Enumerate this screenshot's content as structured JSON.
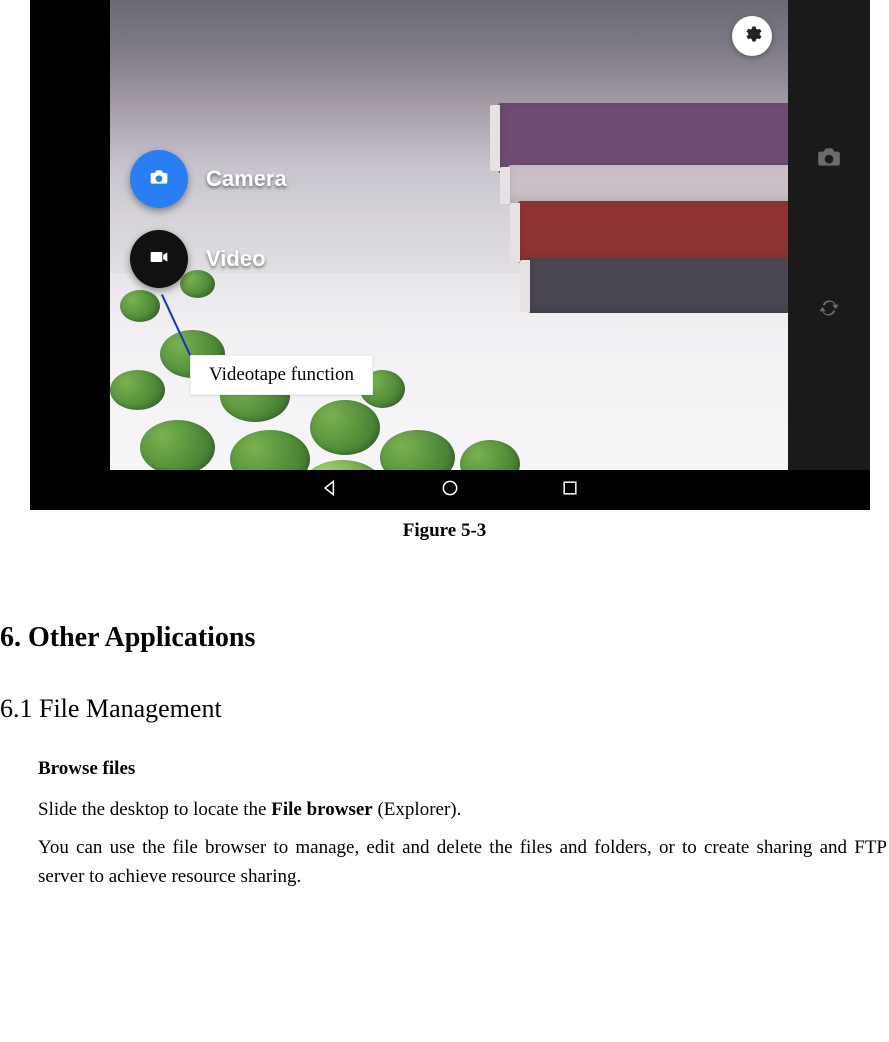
{
  "figure": {
    "caption": "Figure 5-3",
    "modes": {
      "camera_label": "Camera",
      "video_label": "Video"
    },
    "callout": "Videotape function",
    "icons": {
      "settings": "gear-icon",
      "shutter": "camera-icon",
      "switch": "switch-camera-icon",
      "nav_back": "back-icon",
      "nav_home": "home-icon",
      "nav_recent": "recent-icon"
    }
  },
  "doc": {
    "chapter_title": "6. Other Applications",
    "section_title": "6.1 File Management",
    "browse_heading": "Browse files",
    "p1_pre": "Slide the desktop to locate the ",
    "p1_bold": "File browser",
    "p1_post": " (Explorer).",
    "p2": "You can use the file browser to manage, edit and delete the files and folders, or to create sharing and FTP server to achieve resource sharing."
  }
}
